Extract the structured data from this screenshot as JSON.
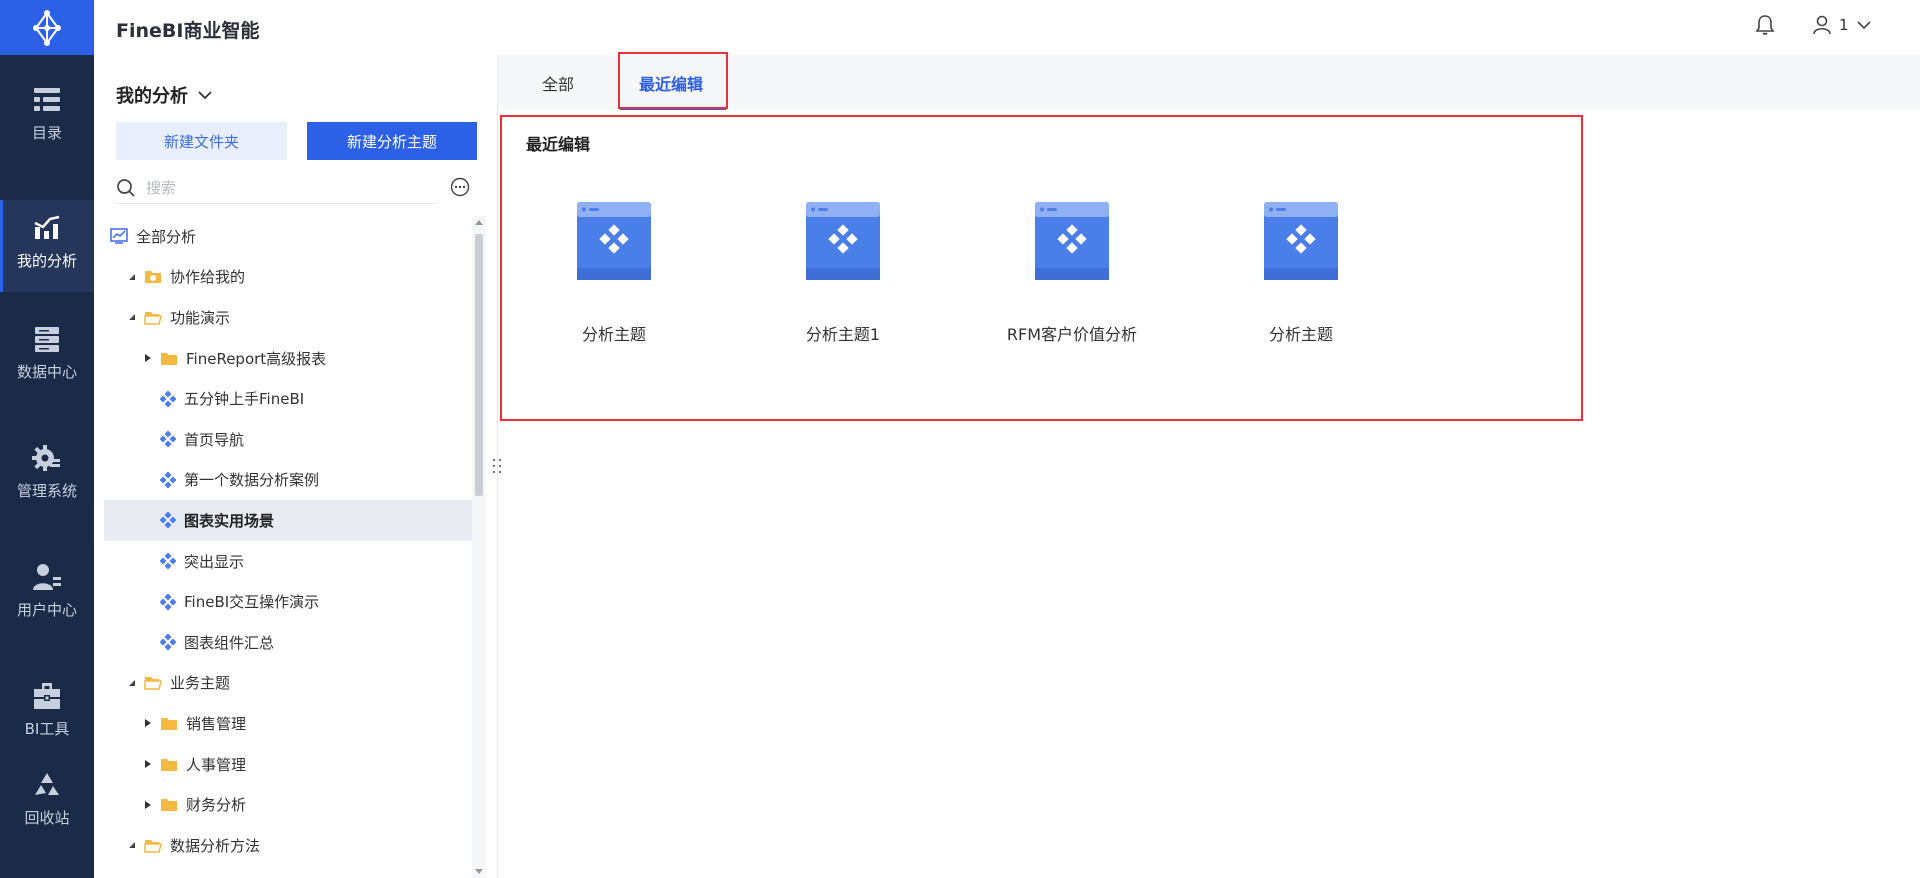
{
  "header": {
    "app_title": "FineBI商业智能",
    "user_name": "1"
  },
  "rail": {
    "items": [
      {
        "label": "目录",
        "icon": "directory-icon"
      },
      {
        "label": "我的分析",
        "icon": "analysis-icon",
        "active": true
      },
      {
        "label": "数据中心",
        "icon": "data-center-icon"
      },
      {
        "label": "管理系统",
        "icon": "gear-icon"
      },
      {
        "label": "用户中心",
        "icon": "user-center-icon"
      },
      {
        "label": "BI工具",
        "icon": "toolbox-icon"
      },
      {
        "label": "回收站",
        "icon": "recycle-icon"
      }
    ]
  },
  "side": {
    "title": "我的分析",
    "new_folder_label": "新建文件夹",
    "new_subject_label": "新建分析主题",
    "search_placeholder": "搜索",
    "tree": [
      {
        "label": "全部分析",
        "type": "all",
        "level": 0
      },
      {
        "label": "协作给我的",
        "type": "share-folder",
        "level": 1,
        "expanded": true
      },
      {
        "label": "功能演示",
        "type": "folder",
        "level": 1,
        "expanded": true
      },
      {
        "label": "FineReport高级报表",
        "type": "folder",
        "level": 2,
        "expanded": false
      },
      {
        "label": "五分钟上手FineBI",
        "type": "subject",
        "level": 2
      },
      {
        "label": "首页导航",
        "type": "subject",
        "level": 2
      },
      {
        "label": "第一个数据分析案例",
        "type": "subject",
        "level": 2
      },
      {
        "label": "图表实用场景",
        "type": "subject",
        "level": 2,
        "selected": true
      },
      {
        "label": "突出显示",
        "type": "subject",
        "level": 2
      },
      {
        "label": "FineBI交互操作演示",
        "type": "subject",
        "level": 2
      },
      {
        "label": "图表组件汇总",
        "type": "subject",
        "level": 2
      },
      {
        "label": "业务主题",
        "type": "folder",
        "level": 1,
        "expanded": true
      },
      {
        "label": "销售管理",
        "type": "folder",
        "level": 2,
        "expanded": false
      },
      {
        "label": "人事管理",
        "type": "folder",
        "level": 2,
        "expanded": false
      },
      {
        "label": "财务分析",
        "type": "folder",
        "level": 2,
        "expanded": false
      },
      {
        "label": "数据分析方法",
        "type": "folder",
        "level": 1,
        "expanded": true
      }
    ]
  },
  "main": {
    "tabs": [
      {
        "label": "全部"
      },
      {
        "label": "最近编辑",
        "active": true
      }
    ],
    "recent_title": "最近编辑",
    "cards": [
      {
        "label": "分析主题"
      },
      {
        "label": "分析主题1"
      },
      {
        "label": "RFM客户价值分析"
      },
      {
        "label": "分析主题"
      }
    ]
  },
  "colors": {
    "accent": "#2c60e6",
    "rail_bg": "#1b2a47",
    "highlight": "#e8323a",
    "folder": "#f5b841"
  }
}
